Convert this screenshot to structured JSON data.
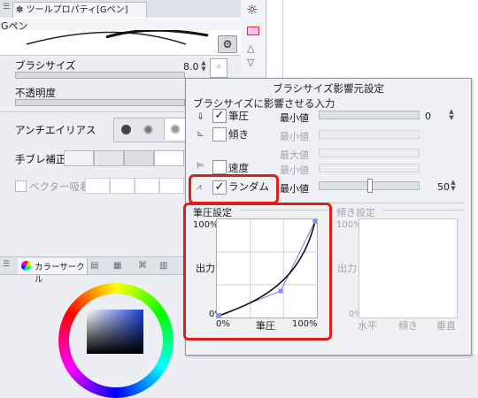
{
  "tool_panel": {
    "tab_title": "ツールプロパティ[Gペン]",
    "preset_name": "Gペン",
    "brush_size_label": "ブラシサイズ",
    "brush_size_value": "8.0",
    "opacity_label": "不透明度",
    "antialias_label": "アンチエイリアス",
    "stabilization_label": "手ブレ補正",
    "vector_snap_label": "ベクター吸着"
  },
  "color_panel": {
    "tab_title": "カラーサークル"
  },
  "dialog": {
    "title": "ブラシサイズ影響元設定",
    "section_label": "ブラシサイズに影響させる入力",
    "rows": [
      {
        "label": "筆圧",
        "checked": true,
        "sublabel": "最小値",
        "value": "0",
        "enabled": true
      },
      {
        "label": "傾き",
        "checked": false,
        "sublabel": "最小値",
        "value": "",
        "enabled": false
      },
      {
        "label": "",
        "checked": false,
        "sublabel": "最大値",
        "value": "",
        "enabled": false
      },
      {
        "label": "速度",
        "checked": false,
        "sublabel": "最小値",
        "value": "",
        "enabled": false
      },
      {
        "label": "ランダム",
        "checked": true,
        "sublabel": "最小値",
        "value": "50",
        "enabled": true
      }
    ],
    "pressure_graph": {
      "title": "筆圧設定",
      "y_top": "100%",
      "y_bottom": "0%",
      "y_label": "出力",
      "x_left": "0%",
      "x_mid": "筆圧",
      "x_right": "100%"
    },
    "tilt_graph": {
      "title": "傾き設定",
      "y_top": "100%",
      "y_bottom": "0%",
      "y_label": "出力",
      "x_left": "水平",
      "x_mid": "傾き",
      "x_right": "垂直"
    },
    "highlight_color": "#e21b1b"
  }
}
